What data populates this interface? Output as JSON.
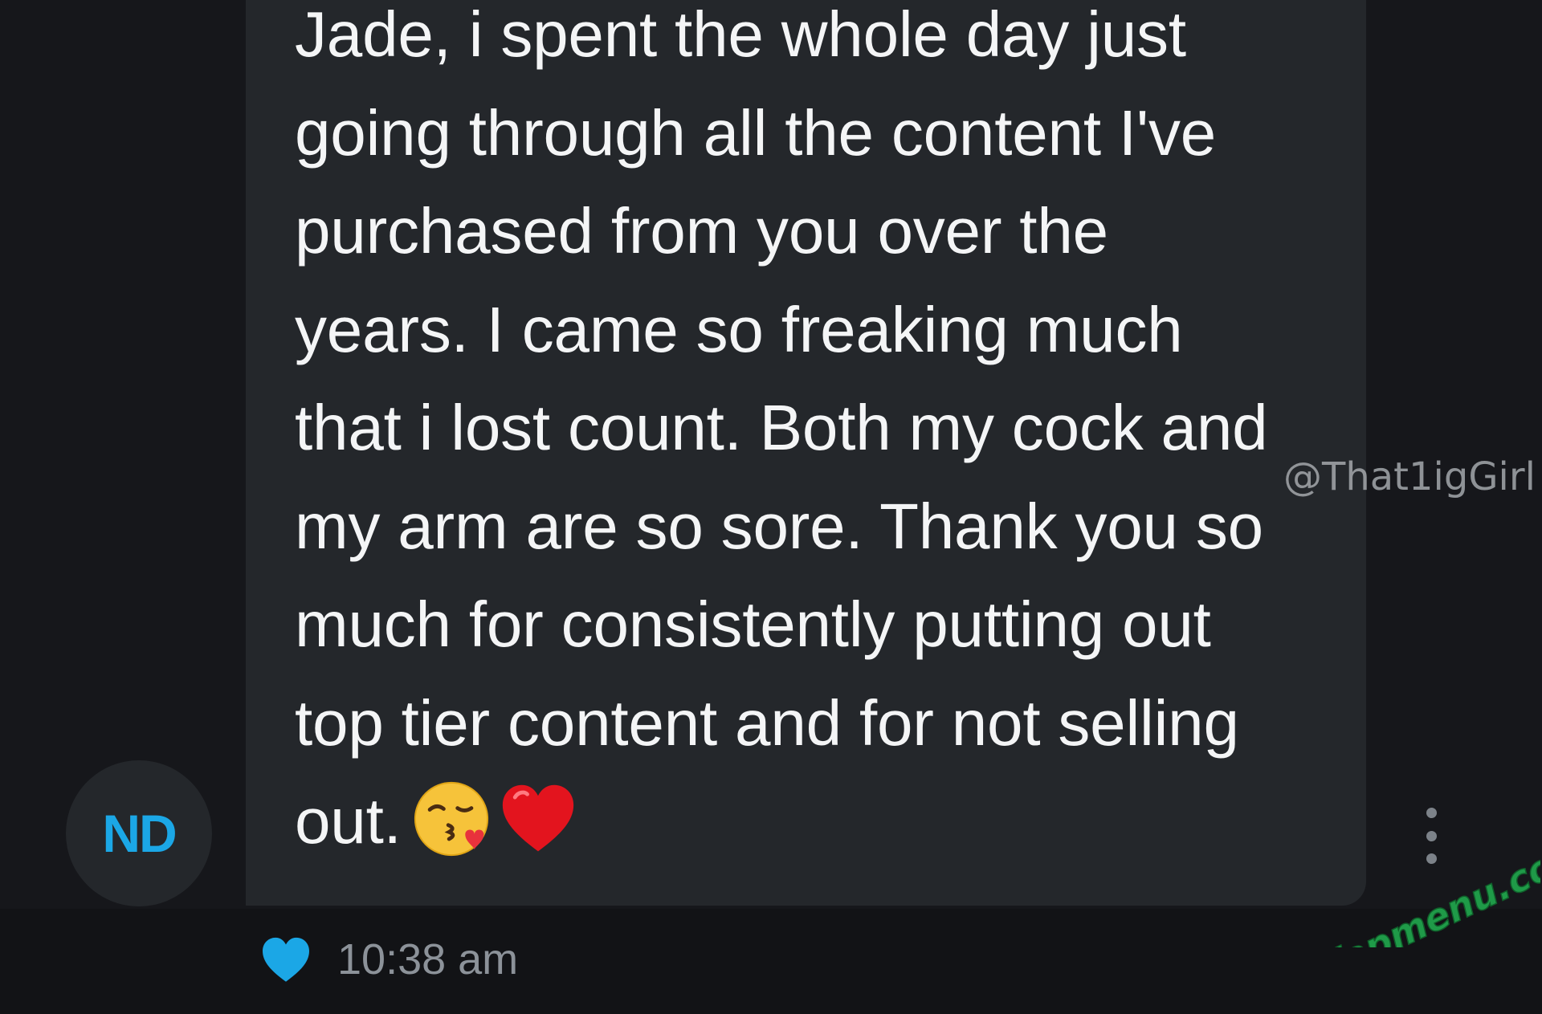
{
  "message": {
    "lines": [
      "Jade, i spent the whole day just",
      "going through all the content I've",
      "purchased from you over the",
      "years. I came so freaking much",
      "that i lost count. Both my cock and",
      "my arm are so sore. Thank you so",
      "much for consistently putting out",
      "top tier content and for not selling",
      "out."
    ],
    "emojis": [
      "kissing-face-with-heart-emoji",
      "red-heart-emoji"
    ],
    "timestamp": "10:38 am",
    "liked": true
  },
  "sender": {
    "initials": "ND"
  },
  "watermarks": {
    "handle": "@That1igGirl",
    "site": "fapmenu.com"
  },
  "colors": {
    "background": "#16171b",
    "bubble": "#24272b",
    "text": "#f4f5f6",
    "accent": "#1ba7e6",
    "timestamp": "#8c9299",
    "logo": "#1f9a48"
  },
  "icons": {
    "like": "heart-icon",
    "more": "more-vertical-icon"
  }
}
